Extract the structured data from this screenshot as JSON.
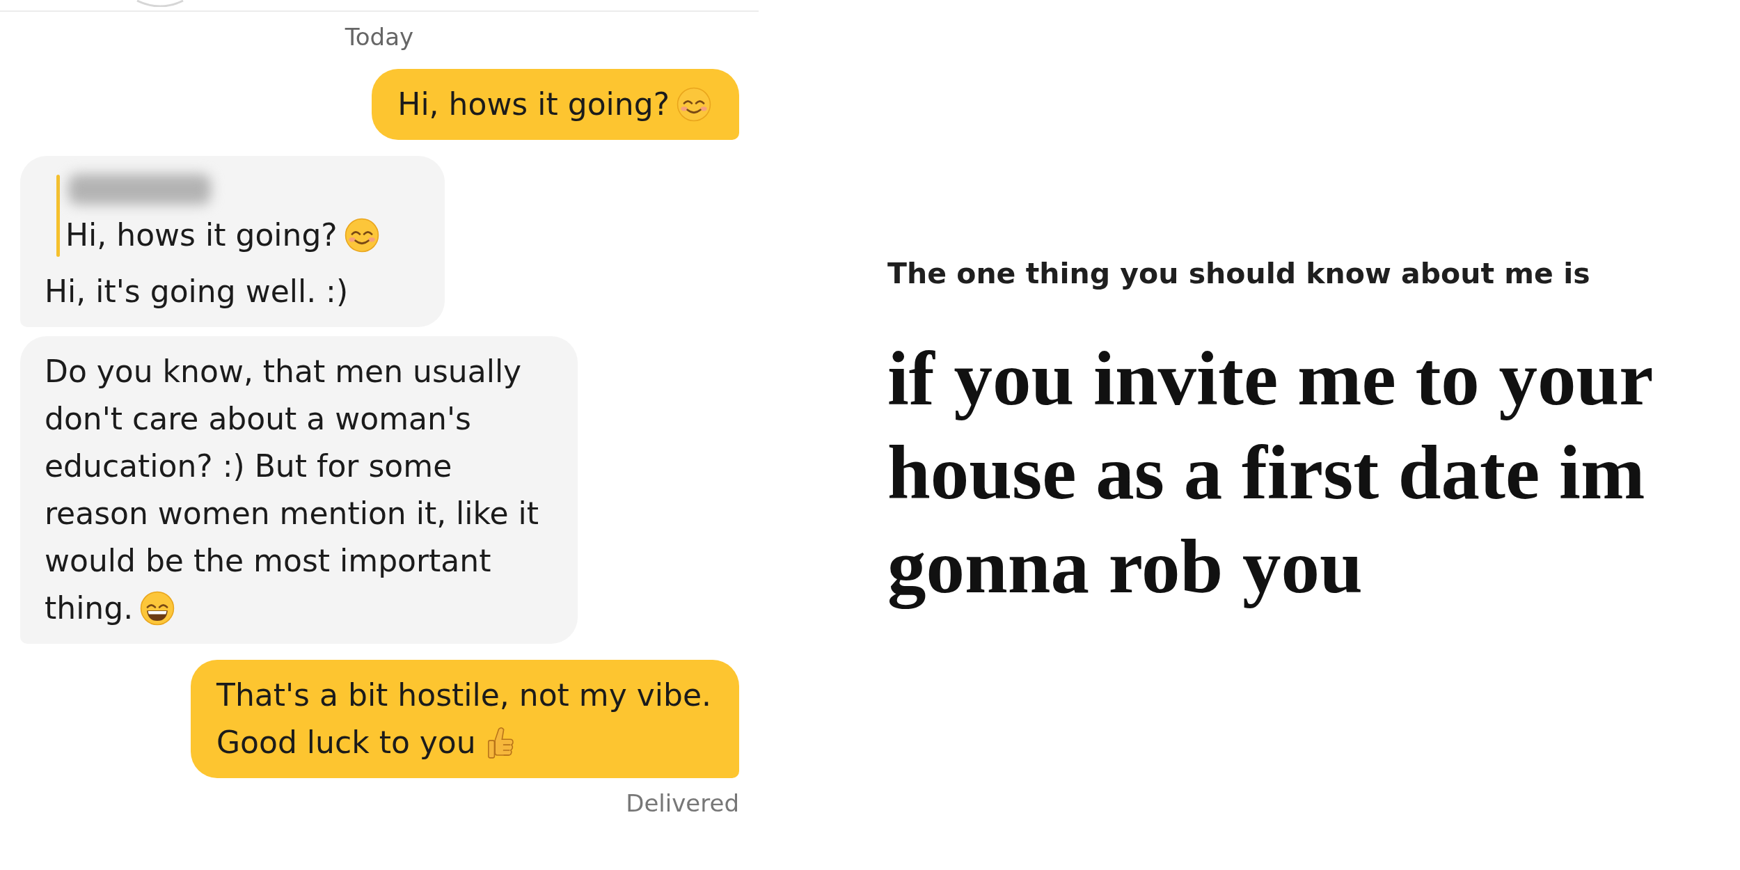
{
  "chat": {
    "date_label": "Today",
    "messages": [
      {
        "kind": "outgoing",
        "lines": [
          "Hi, hows it going?"
        ],
        "trailing_icon": {
          "kind": "smile"
        }
      },
      {
        "kind": "incoming",
        "quote": {
          "text": "Hi, hows it going?",
          "trailing_icon": {
            "kind": "smile"
          }
        },
        "lines": [
          "Hi, it's going well. :)"
        ]
      },
      {
        "kind": "incoming",
        "lines": [
          "Do you know, that men usually",
          "don't care about a woman's",
          "education? :) But for some",
          "reason women mention it, like it",
          "would be the most important",
          "thing."
        ],
        "trailing_icon": {
          "kind": "grin"
        }
      },
      {
        "kind": "outgoing",
        "lines": [
          "That's a bit hostile, not my vibe.",
          "Good luck to you"
        ],
        "trailing_icon": {
          "kind": "thumbs_up"
        }
      }
    ],
    "status": "Delivered"
  },
  "profile_prompt": {
    "question": "The one thing you should know about me is",
    "answer": "if you invite me to your house as a first date im gonna rob you"
  }
}
